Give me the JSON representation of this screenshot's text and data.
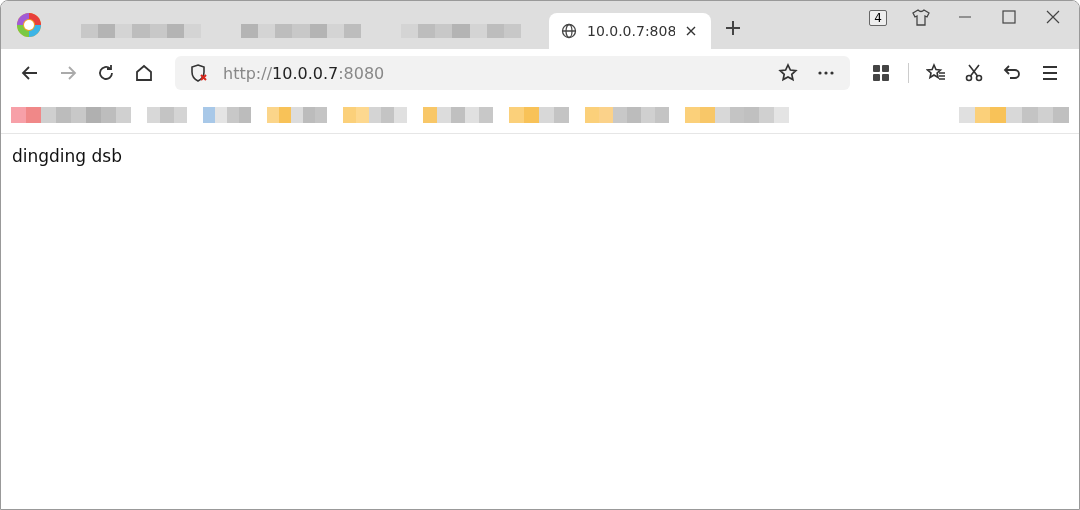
{
  "tabs": [
    {
      "selected": false
    },
    {
      "selected": false
    },
    {
      "selected": false
    },
    {
      "title": "10.0.0.7:808",
      "selected": true
    }
  ],
  "tab_count": "4",
  "address_bar": {
    "scheme": "http://",
    "host": "10.0.0.7",
    "port": ":8080",
    "insecure": true
  },
  "page": {
    "text": "dingding dsb"
  }
}
